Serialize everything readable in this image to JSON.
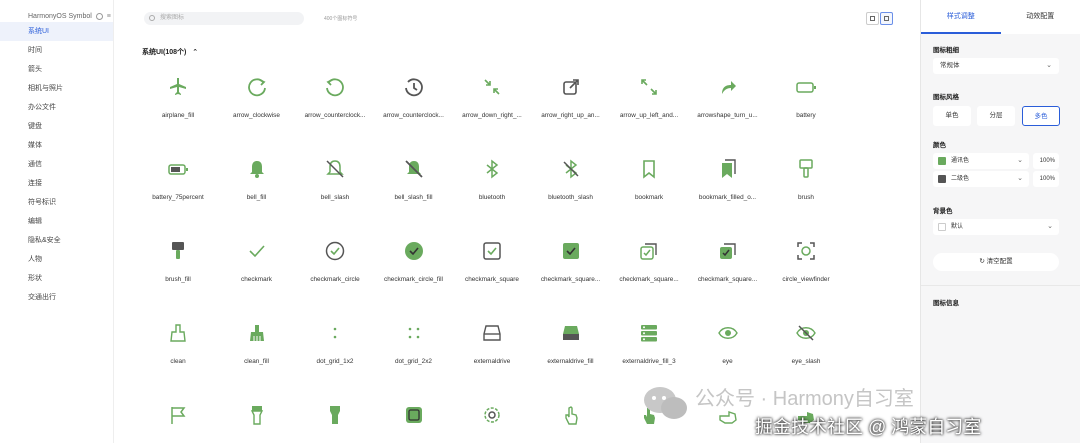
{
  "sidebar": {
    "title": "HarmonyOS Symbol",
    "items": [
      "系统UI",
      "时间",
      "箭头",
      "相机与照片",
      "办公文件",
      "键盘",
      "媒体",
      "通信",
      "连接",
      "符号标识",
      "编辑",
      "隐私&安全",
      "人物",
      "形状",
      "交通出行"
    ]
  },
  "toolbar": {
    "search_placeholder": "搜索图标",
    "count_text": "400个图标符号"
  },
  "section": {
    "label": "系统UI(108个)",
    "chevron": "^"
  },
  "icons": [
    {
      "label": "airplane_fill",
      "icon": "airplane-fill"
    },
    {
      "label": "arrow_clockwise",
      "icon": "arrow-clockwise"
    },
    {
      "label": "arrow_counterclock...",
      "icon": "arrow-counterclockwise"
    },
    {
      "label": "arrow_counterclock...",
      "icon": "arrow-counterclockwise-clock"
    },
    {
      "label": "arrow_down_right_...",
      "icon": "arrow-down-right"
    },
    {
      "label": "arrow_right_up_an...",
      "icon": "arrow-right-up"
    },
    {
      "label": "arrow_up_left_and...",
      "icon": "arrow-up-left-and-down-right"
    },
    {
      "label": "arrowshape_turn_u...",
      "icon": "arrowshape-turn-up"
    },
    {
      "label": "battery",
      "icon": "battery"
    },
    {
      "label": "battery_75percent",
      "icon": "battery-75"
    },
    {
      "label": "bell_fill",
      "icon": "bell-fill"
    },
    {
      "label": "bell_slash",
      "icon": "bell-slash"
    },
    {
      "label": "bell_slash_fill",
      "icon": "bell-slash-fill"
    },
    {
      "label": "bluetooth",
      "icon": "bluetooth"
    },
    {
      "label": "bluetooth_slash",
      "icon": "bluetooth-slash"
    },
    {
      "label": "bookmark",
      "icon": "bookmark"
    },
    {
      "label": "bookmark_filled_o...",
      "icon": "bookmark-filled"
    },
    {
      "label": "brush",
      "icon": "brush"
    },
    {
      "label": "brush_fill",
      "icon": "brush-fill"
    },
    {
      "label": "checkmark",
      "icon": "checkmark"
    },
    {
      "label": "checkmark_circle",
      "icon": "checkmark-circle"
    },
    {
      "label": "checkmark_circle_fill",
      "icon": "checkmark-circle-fill"
    },
    {
      "label": "checkmark_square",
      "icon": "checkmark-square"
    },
    {
      "label": "checkmark_square...",
      "icon": "checkmark-square-fill"
    },
    {
      "label": "checkmark_square...",
      "icon": "checkmark-square-stack"
    },
    {
      "label": "checkmark_square...",
      "icon": "checkmark-square-stack-fill"
    },
    {
      "label": "circle_viewfinder",
      "icon": "circle-viewfinder"
    },
    {
      "label": "clean",
      "icon": "clean"
    },
    {
      "label": "clean_fill",
      "icon": "clean-fill"
    },
    {
      "label": "dot_grid_1x2",
      "icon": "dot-grid-1x2"
    },
    {
      "label": "dot_grid_2x2",
      "icon": "dot-grid-2x2"
    },
    {
      "label": "externaldrive",
      "icon": "externaldrive"
    },
    {
      "label": "externaldrive_fill",
      "icon": "externaldrive-fill"
    },
    {
      "label": "externaldrive_fill_3",
      "icon": "externaldrive-fill-3"
    },
    {
      "label": "eye",
      "icon": "eye"
    },
    {
      "label": "eye_slash",
      "icon": "eye-slash"
    },
    {
      "label": "",
      "icon": "flag"
    },
    {
      "label": "",
      "icon": "flashlight"
    },
    {
      "label": "",
      "icon": "flashlight-fill"
    },
    {
      "label": "",
      "icon": "square-fill"
    },
    {
      "label": "",
      "icon": "gear"
    },
    {
      "label": "",
      "icon": "hand-tap"
    },
    {
      "label": "",
      "icon": "hand-tap-fill"
    },
    {
      "label": "",
      "icon": "hand-point"
    },
    {
      "label": "",
      "icon": "hand-point-fill"
    }
  ],
  "panel": {
    "tabs": [
      "样式调整",
      "动效配置"
    ],
    "weight_title": "图标粗细",
    "weight_value": "常规体",
    "style_title": "图标风格",
    "styles": [
      "单色",
      "分层",
      "多色"
    ],
    "color_title": "颜色",
    "colors": [
      {
        "name": "通讯色",
        "hex": "#6aaa5e",
        "percent": "100%"
      },
      {
        "name": "二级色",
        "hex": "#555555",
        "percent": "100%"
      }
    ],
    "bg_title": "背景色",
    "bg_value": "默认",
    "reset_label": "清空配置",
    "info_title": "图标信息"
  },
  "watermark": {
    "line1": "公众号 · Harmony自习室",
    "line2": "掘金技术社区 @ 鸿蒙自习室"
  },
  "accent": "#6aaa5e"
}
